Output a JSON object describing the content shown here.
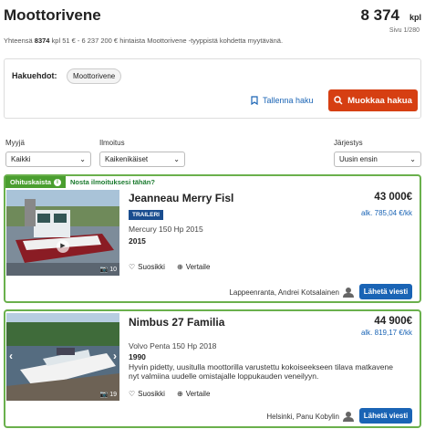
{
  "header": {
    "title": "Moottorivene",
    "count": "8 374",
    "count_unit": "kpl",
    "page_info": "Sivu 1/280",
    "summary_prefix": "Yhteensä ",
    "summary_count": "8374",
    "summary_suffix": " kpl 51 € - 6 237 200 € hintaista Moottorivene -tyyppistä kohdetta myytävänä."
  },
  "search": {
    "criteria_label": "Hakuehdot:",
    "chip": "Moottorivene",
    "save_label": "Tallenna haku",
    "edit_label": "Muokkaa hakua"
  },
  "filters": {
    "sale": {
      "label": "Myyjä",
      "value": "Kaikki"
    },
    "listing": {
      "label": "Ilmoitus",
      "value": "Kaikenikäiset"
    },
    "order": {
      "label": "Järjestys",
      "value": "Uusin ensin"
    }
  },
  "promo": {
    "tag": "Ohituskaista",
    "link": "Nosta ilmoituksesi tähän?"
  },
  "listings": [
    {
      "title": "Jeanneau Merry Fisl",
      "price": "43 000€",
      "price_per_length": "alk. 785,04 €/kk",
      "badge": "TRAILERI",
      "engine": "Mercury 150 Hp 2015",
      "year": "2015",
      "photo_count": "10",
      "favorite": "Suosikki",
      "compare": "Vertaile",
      "seller": "Lappeenranta, Andrei Kotsalainen",
      "message": "Lähetä viesti"
    },
    {
      "title": "Nimbus 27 Familia",
      "price": "44 900€",
      "price_per_length": "alk. 819,17 €/kk",
      "engine": "Volvo Penta 150 Hp 2018",
      "year": "1990",
      "description": "Hyvin pidetty, uusitulla moottorilla varustettu kokoiseekseen tilava matkavene nyt valmiina uudelle omistajalle loppukauden veneilyyn.",
      "photo_count": "19",
      "favorite": "Suosikki",
      "compare": "Vertaile",
      "seller": "Helsinki, Panu Kobylin",
      "message": "Lähetä viesti"
    }
  ]
}
